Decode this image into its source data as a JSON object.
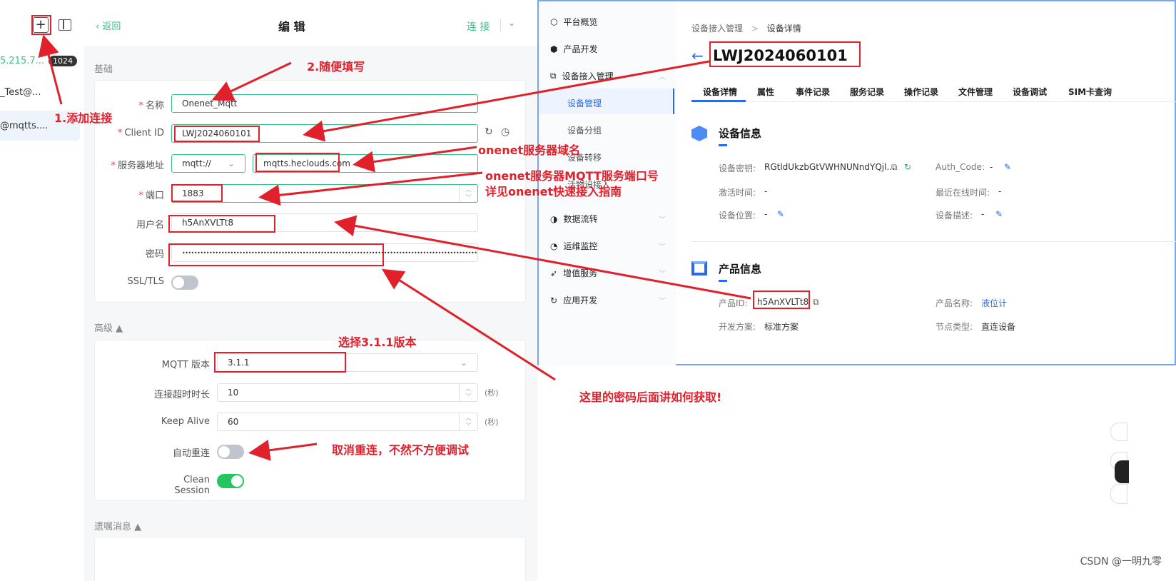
{
  "left_sidebar": {
    "add_icon": "+",
    "connections": [
      {
        "label": "5.215.7...",
        "badge": "1024"
      },
      {
        "label": "_Test@..."
      },
      {
        "label": "@mqtts...."
      }
    ]
  },
  "editor": {
    "back": "返回",
    "title": "编 辑",
    "connect": "连 接",
    "section_basic": "基础",
    "section_advanced": "高级 ▲",
    "section_will": "遗嘱消息 ▲",
    "fields": {
      "name": {
        "label": "名称",
        "value": "Onenet_Mqtt"
      },
      "client_id": {
        "label": "Client ID",
        "value": "LWJ2024060101"
      },
      "host": {
        "label": "服务器地址",
        "protocol": "mqtt://",
        "value": "mqtts.heclouds.com"
      },
      "port": {
        "label": "端口",
        "value": "1883"
      },
      "username": {
        "label": "用户名",
        "value": "h5AnXVLTt8"
      },
      "password": {
        "label": "密码",
        "value": "•••••••••••••••••••••••••••••••••••••••••••••••••••••••••••••••••••••••••••••••••••••••••••••••••••••••••••••••••••••••••••••••••••••••••••"
      },
      "ssl": {
        "label": "SSL/TLS"
      },
      "mqtt_version": {
        "label": "MQTT 版本",
        "value": "3.1.1"
      },
      "timeout": {
        "label": "连接超时时长",
        "value": "10",
        "unit": "(秒)"
      },
      "keepalive": {
        "label": "Keep Alive",
        "value": "60",
        "unit": "(秒)"
      },
      "reconnect": {
        "label": "自动重连"
      },
      "clean_session": {
        "label": "Clean Session"
      }
    }
  },
  "onenet": {
    "nav": {
      "overview": "平台概览",
      "product": "产品开发",
      "device_access": "设备接入管理",
      "device_mgmt": "设备管理",
      "device_group": "设备分组",
      "device_transfer": "设备转移",
      "activation": "活物设接入",
      "data_flow": "数据流转",
      "ops": "运维监控",
      "value_added": "增值服务",
      "app_dev": "应用开发"
    },
    "breadcrumb": [
      "设备接入管理",
      ">",
      "设备详情"
    ],
    "device_name": "LWJ2024060101",
    "tabs": [
      "设备详情",
      "属性",
      "事件记录",
      "服务记录",
      "操作记录",
      "文件管理",
      "设备调试",
      "SIM卡查询"
    ],
    "device_info_title": "设备信息",
    "device_key_label": "设备密钥:",
    "device_key_value": "RGtldUkzbGtVWHNUNndYQjl...",
    "auth_code_label": "Auth_Code:",
    "auth_code_value": "-",
    "activate_label": "激活时间:",
    "activate_value": "-",
    "online_label": "最近在线时间:",
    "online_value": "-",
    "location_label": "设备位置:",
    "location_value": "-",
    "desc_label": "设备描述:",
    "desc_value": "-",
    "product_info_title": "产品信息",
    "product_id_label": "产品ID:",
    "product_id_value": "h5AnXVLTt8",
    "product_name_label": "产品名称:",
    "product_name_value": "液位计",
    "dev_plan_label": "开发方案:",
    "dev_plan_value": "标准方案",
    "node_type_label": "节点类型:",
    "node_type_value": "直连设备"
  },
  "annotations": {
    "a1": "1.添加连接",
    "a2": "2.随便填写",
    "a3": "onenet服务器域名",
    "a4": "onenet服务器MQTT服务端口号",
    "a5": "详见onenet快速接入指南",
    "a6": "选择3.1.1版本",
    "a7": "这里的密码后面讲如何获取!",
    "a8": "取消重连，不然不方便调试"
  },
  "credit": "CSDN @一明九零"
}
